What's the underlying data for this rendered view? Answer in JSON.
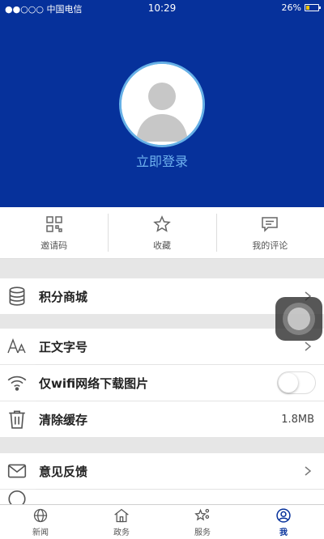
{
  "status_bar": {
    "carrier": "●●○○○ 中国电信",
    "time": "10:29",
    "battery": "26%"
  },
  "profile": {
    "login_text": "立即登录"
  },
  "quick_actions": [
    {
      "icon": "qr-code-icon",
      "label": "邀请码"
    },
    {
      "icon": "star-icon",
      "label": "收藏"
    },
    {
      "icon": "comment-icon",
      "label": "我的评论"
    }
  ],
  "menu": {
    "points_mall": {
      "label": "积分商城",
      "icon": "database-icon"
    },
    "font_size": {
      "label": "正文字号",
      "icon": "font-size-icon"
    },
    "wifi_images": {
      "label": "仅wifi网络下载图片",
      "icon": "wifi-icon",
      "enabled": false
    },
    "clear_cache": {
      "label": "清除缓存",
      "icon": "trash-icon",
      "value": "1.8MB"
    },
    "feedback": {
      "label": "意见反馈",
      "icon": "mail-icon"
    }
  },
  "tabs": [
    {
      "label": "新闻",
      "icon": "globe-icon",
      "active": false
    },
    {
      "label": "政务",
      "icon": "government-icon",
      "active": false
    },
    {
      "label": "服务",
      "icon": "service-icon",
      "active": false
    },
    {
      "label": "我",
      "icon": "user-icon",
      "active": true
    }
  ],
  "colors": {
    "brand": "#06319b",
    "link": "#6fb2ef"
  }
}
